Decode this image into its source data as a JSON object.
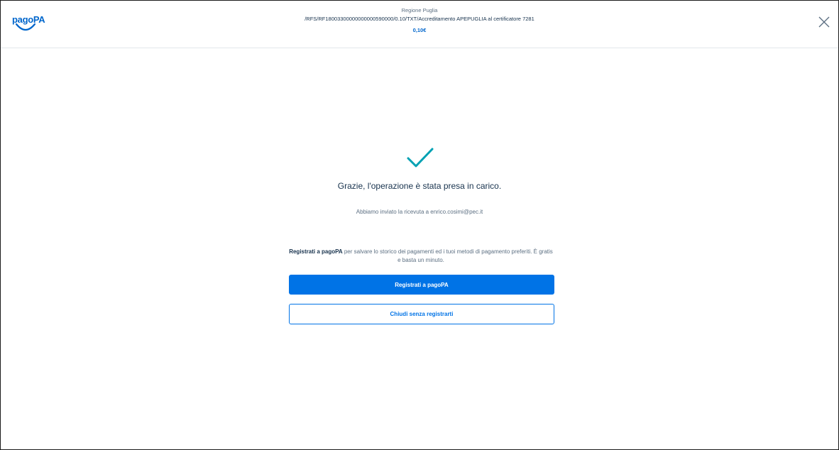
{
  "header": {
    "logo_text": "pagoPA",
    "creditor": "Regione Puglia",
    "subject": "/RFS/RF18003300000000000590000/0.10/TXT/Accreditamento APEPUGLIA al certificatore 7281",
    "amount": "0,10€",
    "close_icon": "close-icon"
  },
  "main": {
    "success_icon": "checkmark-icon",
    "title": "Grazie, l'operazione è stata presa in carico.",
    "receipt_message": "Abbiamo inviato la ricevuta a enrico.cosimi@pec.it",
    "promo_bold": "Registrati a pagoPA",
    "promo_rest": " per salvare lo storico dei pagamenti ed i tuoi metodi di pagamento preferiti. È gratis e basta un minuto.",
    "register_button": "Registrati a pagoPA",
    "close_button": "Chiudi senza registrarti"
  },
  "colors": {
    "brand_blue": "#0073e6",
    "check_teal": "#00a1b3",
    "text_dark": "#17324d",
    "text_muted": "#5c6f82"
  }
}
